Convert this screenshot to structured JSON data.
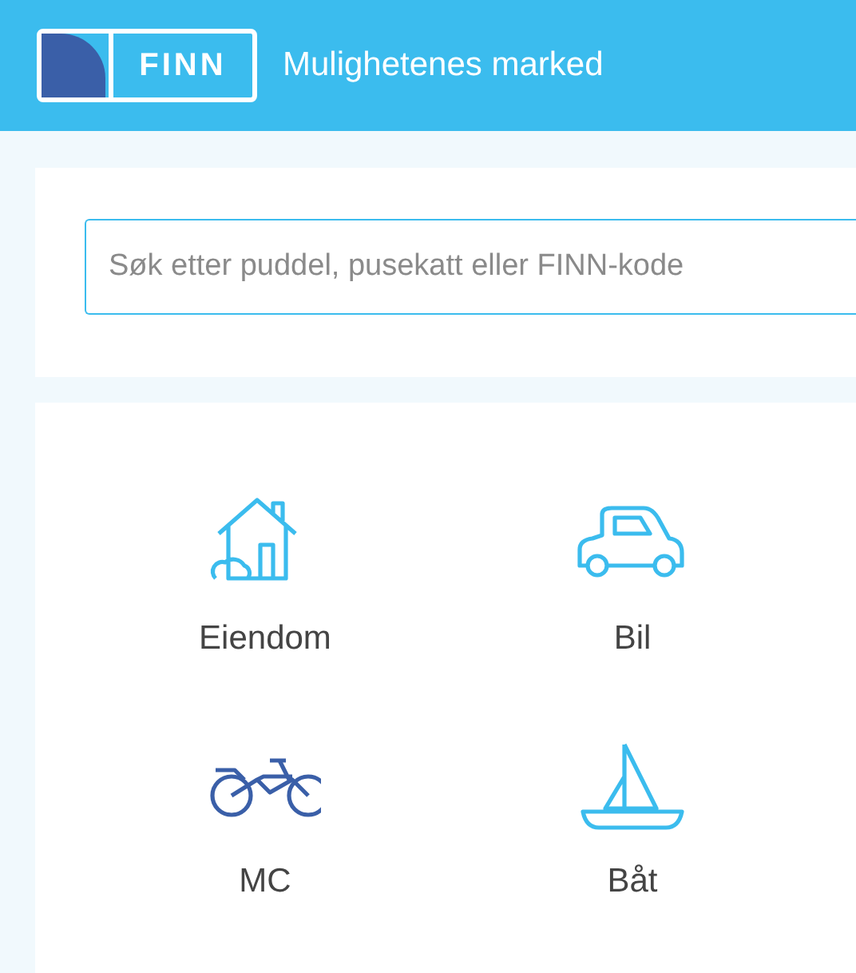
{
  "header": {
    "logo": "FINN",
    "tagline": "Mulighetenes marked"
  },
  "search": {
    "placeholder": "Søk etter puddel, pusekatt eller FINN-kode"
  },
  "categories": [
    {
      "label": "Eiendom",
      "kind": "house"
    },
    {
      "label": "Bil",
      "kind": "car"
    },
    {
      "label": "MC",
      "kind": "bike"
    },
    {
      "label": "Båt",
      "kind": "boat"
    }
  ]
}
